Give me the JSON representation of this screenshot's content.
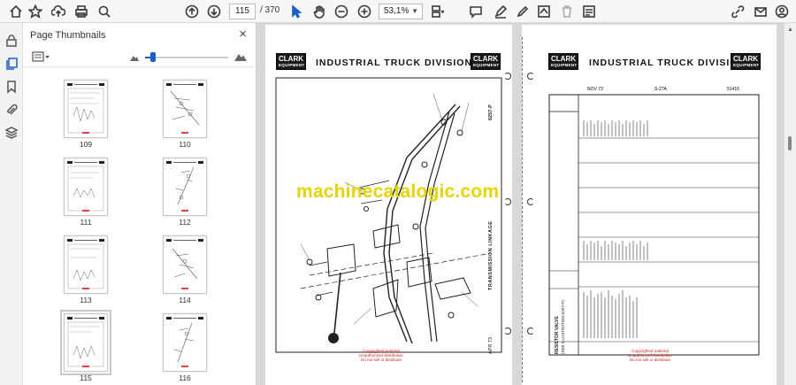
{
  "toolbar": {
    "page_current": "115",
    "page_total": "/ 370",
    "zoom": "53,1%"
  },
  "panel": {
    "title": "Page Thumbnails",
    "close": "×"
  },
  "thumbnails": [
    {
      "label": "109"
    },
    {
      "label": "110"
    },
    {
      "label": "111"
    },
    {
      "label": "112"
    },
    {
      "label": "113"
    },
    {
      "label": "114"
    },
    {
      "label": "115"
    },
    {
      "label": "116"
    }
  ],
  "document": {
    "logo_line1": "CLARK",
    "logo_line2": "EQUIPMENT",
    "division_title": "INDUSTRIAL TRUCK DIVISION",
    "left_rot_title": "TRANSMISSION LINKAGE",
    "left_rot_code": "6257-P",
    "left_rot_date": "APR 73",
    "right_date": "NOV 73",
    "right_code1": "S-27A",
    "right_code2": "51416",
    "right_rot_header": "RESISTOR VALVE",
    "right_rot_header2": "(SEE ILLUSTRATION 6257-P)",
    "watermark": "machinecatalogic.com",
    "red_note_line1": "Copyrighted material",
    "red_note_line2": "Unauthorized distribution",
    "red_note_line3": "Do not sell or distribute"
  }
}
